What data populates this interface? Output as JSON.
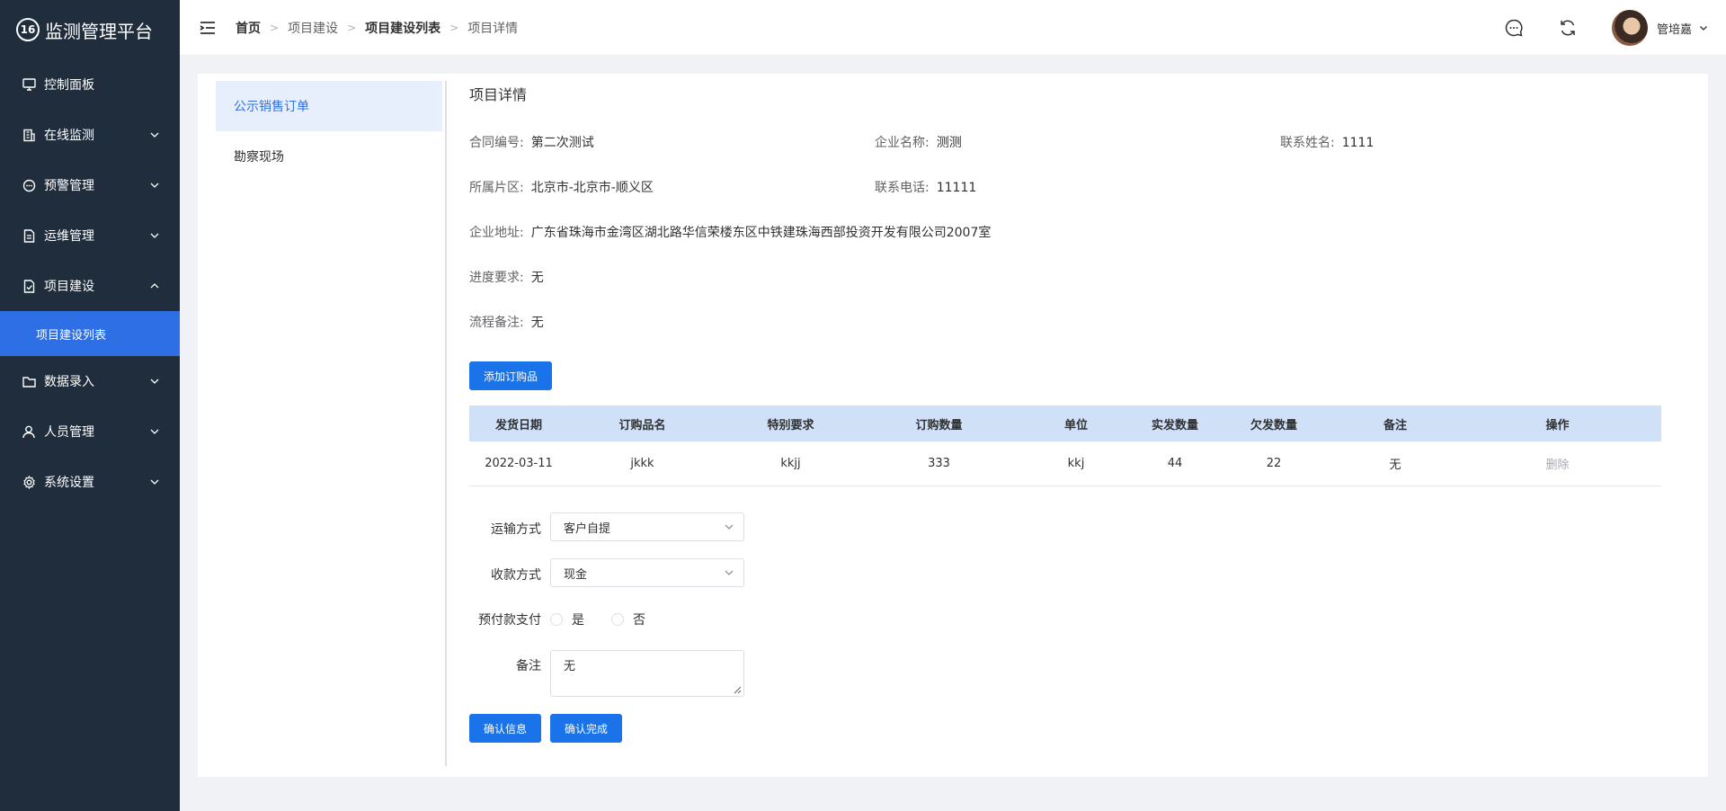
{
  "app": {
    "title": "监测管理平台",
    "logo_mark": "16"
  },
  "sidebar": {
    "items": [
      {
        "label": "控制面板",
        "icon": "monitor-icon",
        "has_children": false
      },
      {
        "label": "在线监测",
        "icon": "building-icon",
        "has_children": true
      },
      {
        "label": "预警管理",
        "icon": "chat-icon",
        "has_children": true
      },
      {
        "label": "运维管理",
        "icon": "document-icon",
        "has_children": true
      },
      {
        "label": "项目建设",
        "icon": "document-check-icon",
        "has_children": true,
        "expanded": true
      },
      {
        "label": "数据录入",
        "icon": "folder-icon",
        "has_children": true
      },
      {
        "label": "人员管理",
        "icon": "user-icon",
        "has_children": true
      },
      {
        "label": "系统设置",
        "icon": "settings-icon",
        "has_children": true
      }
    ],
    "active_sub": "项目建设列表"
  },
  "header": {
    "breadcrumb": [
      "首页",
      "项目建设",
      "项目建设列表",
      "项目详情"
    ],
    "user_name": "管培嘉"
  },
  "tabs": [
    "公示销售订单",
    "勘察现场"
  ],
  "detail": {
    "title": "项目详情",
    "contract_no": {
      "label": "合同编号:",
      "value": "第二次测试"
    },
    "company_name": {
      "label": "企业名称:",
      "value": "测测"
    },
    "contact_name": {
      "label": "联系姓名:",
      "value": "1111"
    },
    "region": {
      "label": "所属片区:",
      "value": "北京市-北京市-顺义区"
    },
    "contact_phone": {
      "label": "联系电话:",
      "value": "11111"
    },
    "company_address": {
      "label": "企业地址:",
      "value": "广东省珠海市金湾区湖北路华信荣楼东区中铁建珠海西部投资开发有限公司2007室"
    },
    "progress_req": {
      "label": "进度要求:",
      "value": "无"
    },
    "process_note": {
      "label": "流程备注:",
      "value": "无"
    }
  },
  "add_button": "添加订购品",
  "table": {
    "headers": [
      "发货日期",
      "订购品名",
      "特别要求",
      "订购数量",
      "单位",
      "实发数量",
      "欠发数量",
      "备注",
      "操作"
    ],
    "rows": [
      [
        "2022-03-11",
        "jkkk",
        "kkjj",
        "333",
        "kkj",
        "44",
        "22",
        "无",
        "删除"
      ]
    ]
  },
  "form": {
    "transport": {
      "label": "运输方式",
      "value": "客户自提"
    },
    "payment": {
      "label": "收款方式",
      "value": "现金"
    },
    "prepay": {
      "label": "预付款支付",
      "options": [
        "是",
        "否"
      ]
    },
    "remark": {
      "label": "备注",
      "value": "无"
    }
  },
  "actions": {
    "confirm_info": "确认信息",
    "confirm_done": "确认完成"
  },
  "colors": {
    "sidebar": "#1f2d3d",
    "accent": "#1a73e8",
    "active_sub": "#2f6fe5",
    "table_head": "#cfe0f7"
  }
}
